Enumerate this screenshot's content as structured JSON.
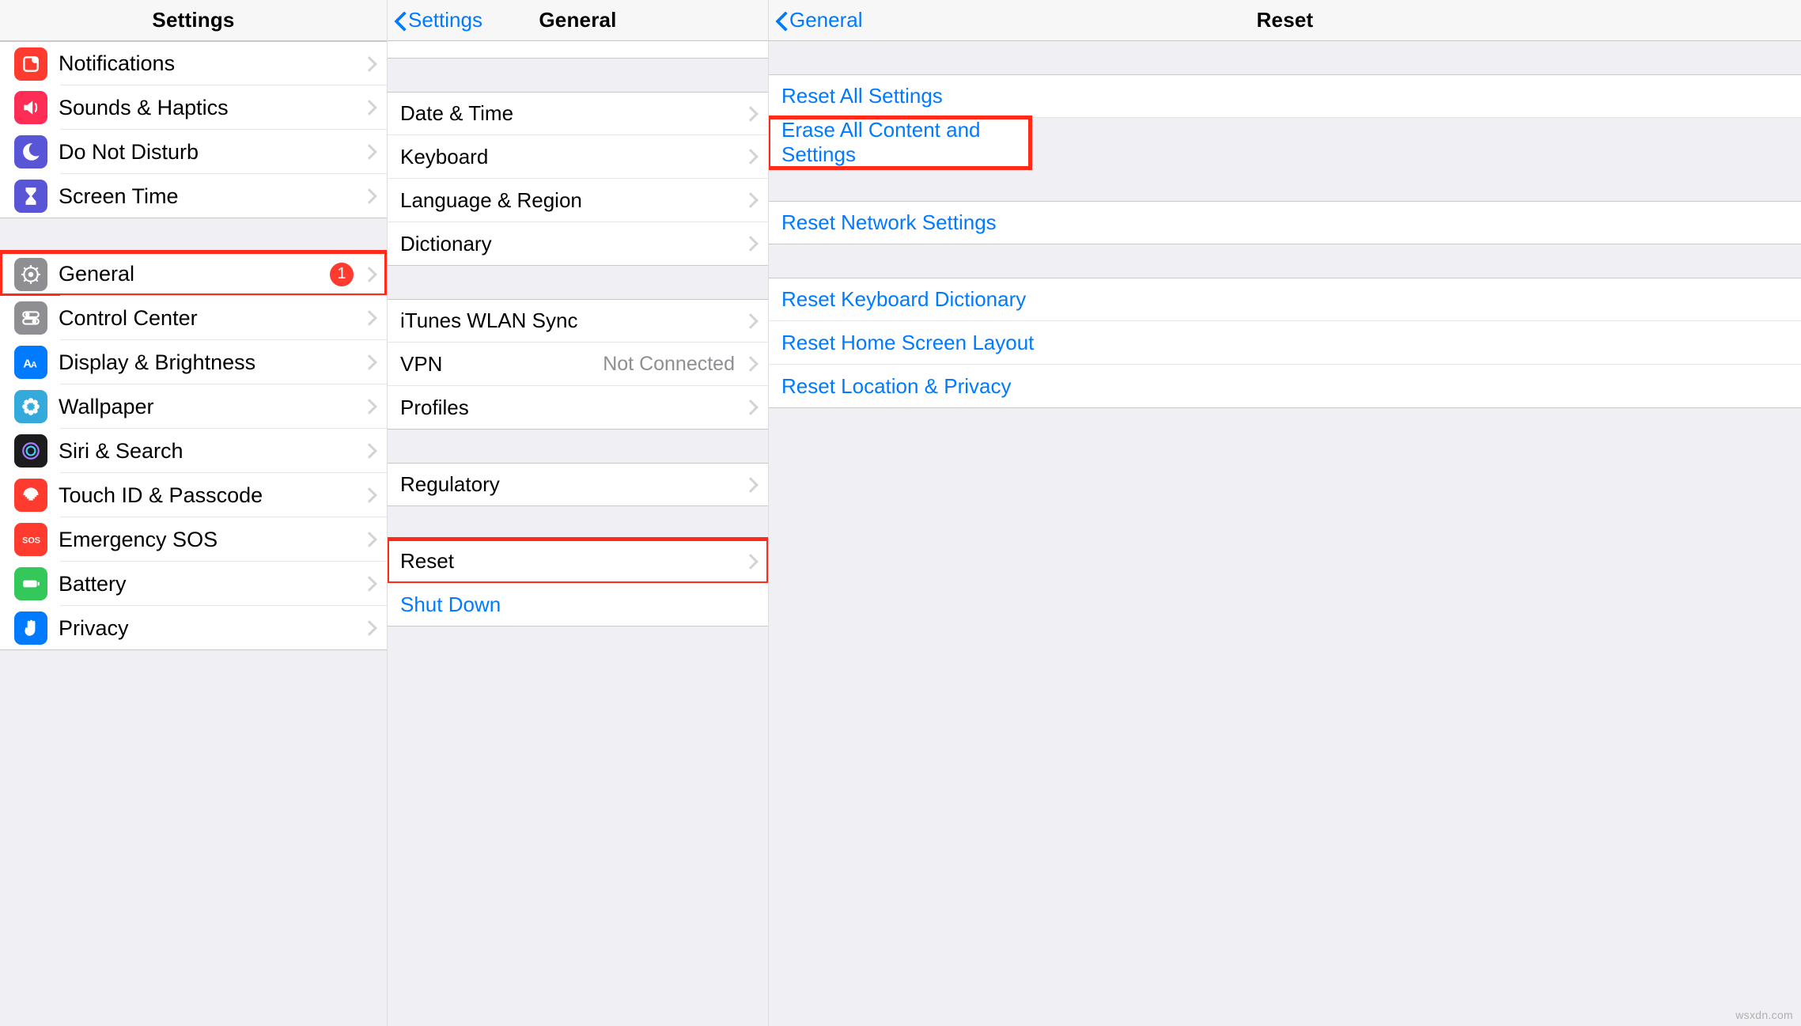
{
  "watermark": "wsxdn.com",
  "pane1": {
    "title": "Settings",
    "group1": [
      {
        "id": "notifications",
        "label": "Notifications",
        "icon": "notifications-icon",
        "bg": "bg-red"
      },
      {
        "id": "sounds",
        "label": "Sounds & Haptics",
        "icon": "sounds-icon",
        "bg": "bg-pink"
      },
      {
        "id": "dnd",
        "label": "Do Not Disturb",
        "icon": "moon-icon",
        "bg": "bg-indigo"
      },
      {
        "id": "screentime",
        "label": "Screen Time",
        "icon": "hourglass-icon",
        "bg": "bg-indigo"
      }
    ],
    "group2": [
      {
        "id": "general",
        "label": "General",
        "icon": "gear-icon",
        "bg": "bg-gray",
        "badge": "1",
        "highlight": true
      },
      {
        "id": "controlcenter",
        "label": "Control Center",
        "icon": "toggles-icon",
        "bg": "bg-gray"
      },
      {
        "id": "display",
        "label": "Display & Brightness",
        "icon": "text-size-icon",
        "bg": "bg-blue"
      },
      {
        "id": "wallpaper",
        "label": "Wallpaper",
        "icon": "flower-icon",
        "bg": "bg-cyan"
      },
      {
        "id": "siri",
        "label": "Siri & Search",
        "icon": "siri-icon",
        "bg": "bg-black"
      },
      {
        "id": "touchid",
        "label": "Touch ID & Passcode",
        "icon": "fingerprint-icon",
        "bg": "bg-red"
      },
      {
        "id": "sos",
        "label": "Emergency SOS",
        "icon": "sos-icon",
        "bg": "bg-red"
      },
      {
        "id": "battery",
        "label": "Battery",
        "icon": "battery-icon",
        "bg": "bg-green"
      },
      {
        "id": "privacy",
        "label": "Privacy",
        "icon": "hand-icon",
        "bg": "bg-hand"
      }
    ]
  },
  "pane2": {
    "back": "Settings",
    "title": "General",
    "group1": [
      {
        "id": "datetime",
        "label": "Date & Time"
      },
      {
        "id": "keyboard",
        "label": "Keyboard"
      },
      {
        "id": "language",
        "label": "Language & Region"
      },
      {
        "id": "dictionary",
        "label": "Dictionary"
      }
    ],
    "group2": [
      {
        "id": "itunes",
        "label": "iTunes WLAN Sync"
      },
      {
        "id": "vpn",
        "label": "VPN",
        "detail": "Not Connected"
      },
      {
        "id": "profiles",
        "label": "Profiles"
      }
    ],
    "group3": [
      {
        "id": "regulatory",
        "label": "Regulatory"
      }
    ],
    "group4": [
      {
        "id": "reset",
        "label": "Reset",
        "highlight": true
      },
      {
        "id": "shutdown",
        "label": "Shut Down",
        "linkBlue": true,
        "noChevron": true
      }
    ]
  },
  "pane3": {
    "back": "General",
    "title": "Reset",
    "group1": [
      {
        "id": "reset-all",
        "label": "Reset All Settings"
      },
      {
        "id": "erase-all",
        "label": "Erase All Content and Settings",
        "highlight": true
      }
    ],
    "group2": [
      {
        "id": "reset-net",
        "label": "Reset Network Settings"
      }
    ],
    "group3": [
      {
        "id": "reset-kb",
        "label": "Reset Keyboard Dictionary"
      },
      {
        "id": "reset-home",
        "label": "Reset Home Screen Layout"
      },
      {
        "id": "reset-loc",
        "label": "Reset Location & Privacy"
      }
    ]
  }
}
